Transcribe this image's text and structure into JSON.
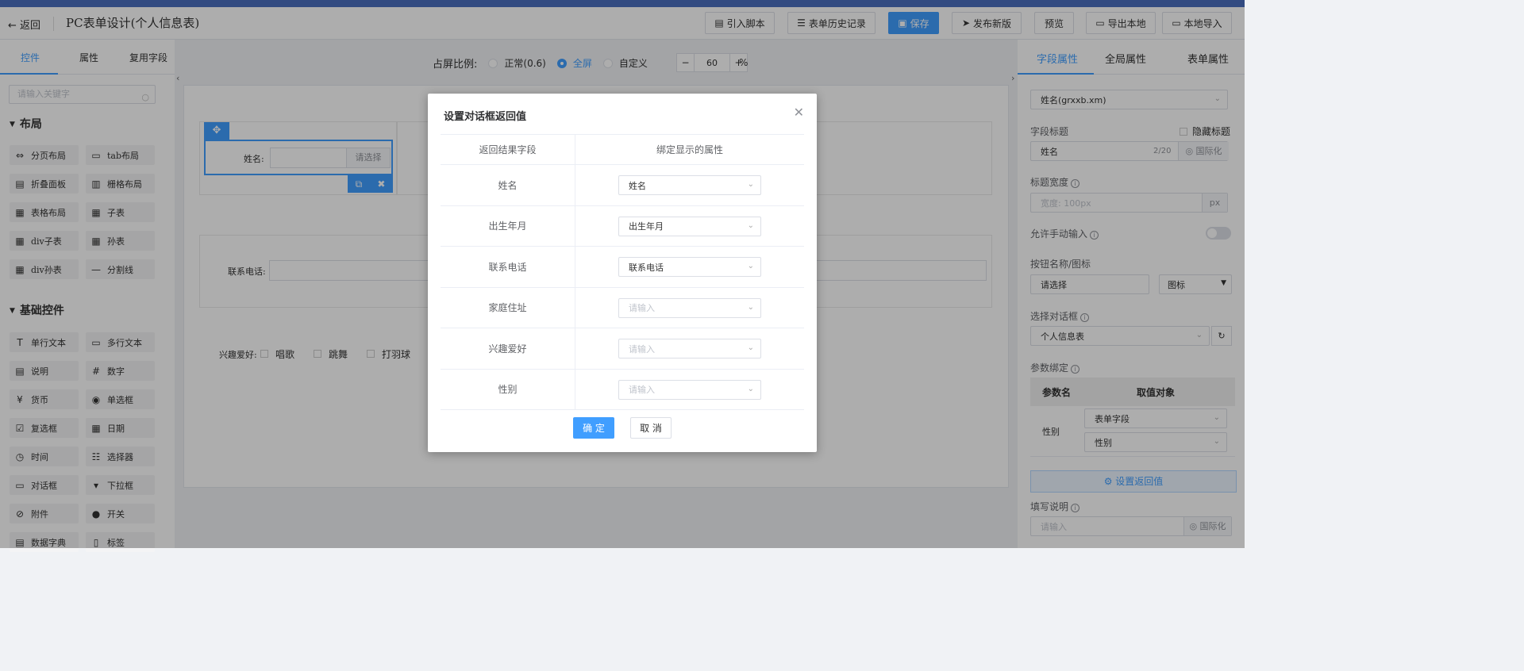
{
  "header": {
    "back_label": "返回",
    "title": "PC表单设计(个人信息表)",
    "buttons": {
      "script": "引入脚本",
      "history": "表单历史记录",
      "save": "保存",
      "publish": "发布新版",
      "preview": "预览",
      "export": "导出本地",
      "import": "本地导入"
    }
  },
  "left_panel": {
    "tabs": [
      "控件",
      "属性",
      "复用字段"
    ],
    "search_placeholder": "请输入关键字",
    "layout_section": "布局",
    "layout_items": [
      "分页布局",
      "tab布局",
      "折叠面板",
      "栅格布局",
      "表格布局",
      "子表",
      "div子表",
      "孙表",
      "div孙表",
      "分割线"
    ],
    "basic_section": "基础控件",
    "basic_items": [
      "单行文本",
      "多行文本",
      "说明",
      "数字",
      "货币",
      "单选框",
      "复选框",
      "日期",
      "时间",
      "选择器",
      "对话框",
      "下拉框",
      "附件",
      "开关",
      "数据字典",
      "标签"
    ]
  },
  "center": {
    "ratio_label": "占屏比例:",
    "ratio_options": [
      "正常(0.6)",
      "全屏",
      "自定义"
    ],
    "ratio_selected": "全屏",
    "zoom_value": "60",
    "zoom_unit": "%",
    "zoom_minus": "−",
    "zoom_plus": "+",
    "form": {
      "name_label": "姓名:",
      "name_button": "请选择",
      "phone_label": "联系电话:",
      "hobby_label": "兴趣爱好:",
      "hobby_options": [
        "唱歌",
        "跳舞",
        "打羽球"
      ]
    }
  },
  "right_panel": {
    "tabs": [
      "字段属性",
      "全局属性",
      "表单属性"
    ],
    "field_select": "姓名(grxxb.xm)",
    "title_label": "字段标题",
    "hide_title_label": "隐藏标题",
    "title_value": "姓名",
    "title_count": "2/20",
    "i18n_label": "国际化",
    "width_label": "标题宽度",
    "width_placeholder": "宽度: 100px",
    "width_unit": "px",
    "manual_input_label": "允许手动输入",
    "button_name_label": "按钮名称/图标",
    "button_name_value": "请选择",
    "icon_label": "图标",
    "dialog_label": "选择对话框",
    "dialog_value": "个人信息表",
    "param_label": "参数绑定",
    "param_headers": [
      "参数名",
      "取值对象"
    ],
    "param_row": {
      "name": "性别",
      "type": "表单字段",
      "value": "性别"
    },
    "set_return_label": "设置返回值",
    "fill_desc_label": "填写说明",
    "fill_desc_placeholder": "请输入",
    "i18n_label2": "国际化"
  },
  "modal": {
    "title": "设置对话框返回值",
    "headers": [
      "返回结果字段",
      "绑定显示的属性"
    ],
    "rows": [
      {
        "field": "姓名",
        "value": "姓名",
        "placeholder": false
      },
      {
        "field": "出生年月",
        "value": "出生年月",
        "placeholder": false
      },
      {
        "field": "联系电话",
        "value": "联系电话",
        "placeholder": false
      },
      {
        "field": "家庭住址",
        "value": "请输入",
        "placeholder": true
      },
      {
        "field": "兴趣爱好",
        "value": "请输入",
        "placeholder": true
      },
      {
        "field": "性别",
        "value": "请输入",
        "placeholder": true
      }
    ],
    "ok_label": "确 定",
    "cancel_label": "取 消"
  },
  "colors": {
    "primary": "#409eff",
    "overlay": "rgba(0,0,0,0.32)"
  }
}
